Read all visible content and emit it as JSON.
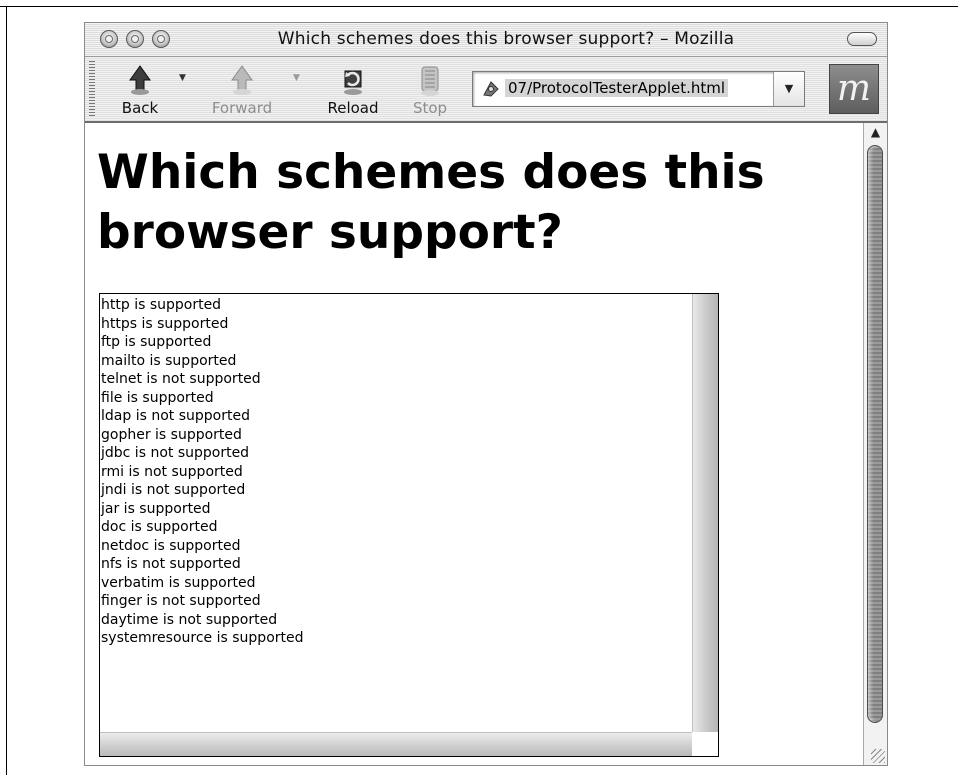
{
  "window": {
    "title": "Which schemes does this browser support? – Mozilla"
  },
  "toolbar": {
    "back_label": "Back",
    "forward_label": "Forward",
    "reload_label": "Reload",
    "stop_label": "Stop",
    "url": "07/ProtocolTesterApplet.html",
    "throbber_letter": "m"
  },
  "page": {
    "heading": "Which schemes does this browser support?"
  },
  "applet": {
    "lines": [
      "http is supported",
      "https is supported",
      "ftp is supported",
      "mailto is supported",
      "telnet is not supported",
      "file is supported",
      "ldap is not supported",
      "gopher is supported",
      "jdbc is not supported",
      "rmi is not supported",
      "jndi is not supported",
      "jar is supported",
      "doc is supported",
      "netdoc is supported",
      "nfs is not supported",
      "verbatim is supported",
      "finger is not supported",
      "daytime is not supported",
      "systemresource is supported"
    ]
  },
  "icons": {
    "traffic_lights": [
      "close-button-icon",
      "minimize-button-icon",
      "zoom-button-icon"
    ],
    "toolbar": [
      "back-arrow-icon",
      "forward-arrow-icon",
      "reload-icon",
      "stop-icon",
      "page-file-icon",
      "mozilla-throbber-icon"
    ]
  }
}
